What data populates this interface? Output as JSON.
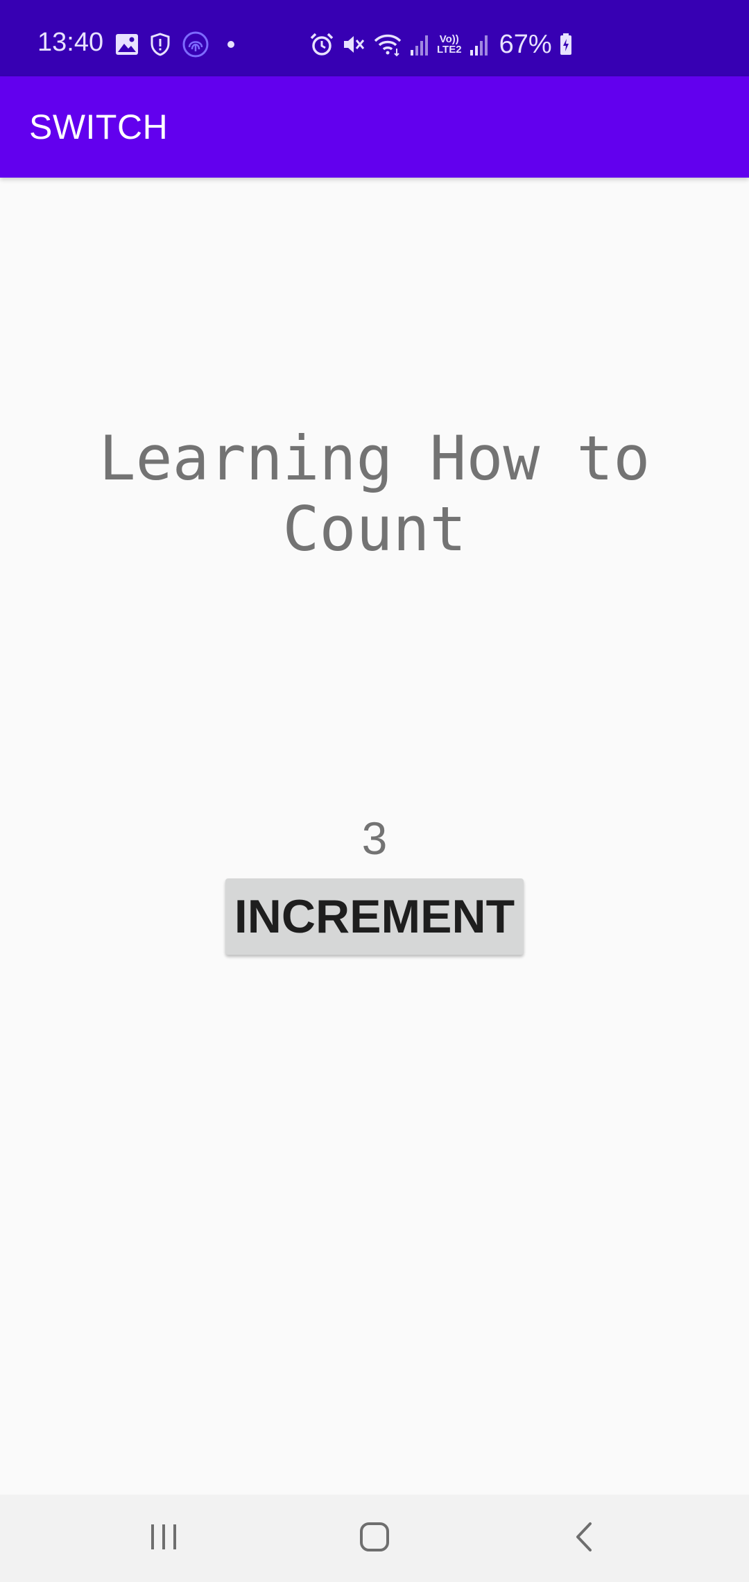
{
  "status_bar": {
    "time": "13:40",
    "battery": "67%",
    "network_label_top": "Vo))",
    "network_label_bottom": "LTE2",
    "left_icons": [
      "gallery-icon",
      "shield-icon",
      "fingerprint-icon",
      "dot-icon"
    ],
    "right_icons": [
      "alarm-icon",
      "mute-icon",
      "wifi-icon",
      "signal-icon",
      "signal-icon",
      "battery-charging-icon"
    ],
    "background": "#3700B3"
  },
  "app_bar": {
    "title": "SWITCH",
    "background": "#6200EE"
  },
  "main": {
    "heading": "Learning How to Count",
    "count": "3",
    "increment_label": "INCREMENT"
  },
  "nav_bar": {
    "buttons": [
      "recents-icon",
      "home-icon",
      "back-icon"
    ]
  }
}
